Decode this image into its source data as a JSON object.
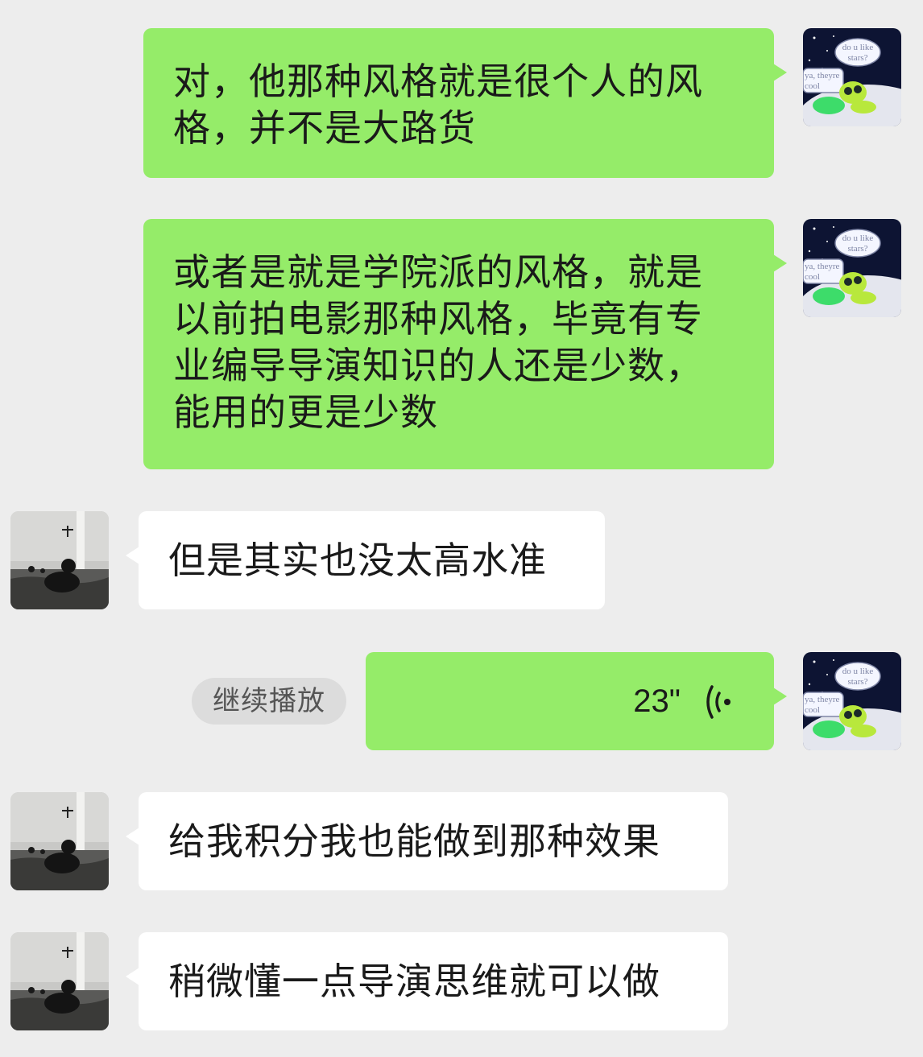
{
  "messages": [
    {
      "side": "right",
      "type": "text",
      "text_lines": [
        "对，他那种风格就是很个人的风",
        "格，并不是大路货"
      ]
    },
    {
      "side": "right",
      "type": "text",
      "text_lines": [
        "或者是就是学院派的风格，就是",
        "以前拍电影那种风格，毕竟有专",
        "业编导导演知识的人还是少数，",
        "能用的更是少数"
      ]
    },
    {
      "side": "left",
      "type": "text",
      "text_lines": [
        "但是其实也没太高水准"
      ]
    },
    {
      "side": "right",
      "type": "voice",
      "duration": "23\"",
      "continue_label": "继续播放"
    },
    {
      "side": "left",
      "type": "text",
      "text_lines": [
        "给我积分我也能做到那种效果"
      ]
    },
    {
      "side": "left",
      "type": "text",
      "text_lines": [
        "稍微懂一点导演思维就可以做"
      ]
    }
  ],
  "avatars": {
    "self": {
      "icon": "alien-cartoon-avatar",
      "caption_top": [
        "do u like",
        "stars?"
      ],
      "caption_left": [
        "ya, theyre",
        "cool"
      ]
    },
    "other": {
      "icon": "ocean-swimmer-photo-avatar"
    }
  },
  "colors": {
    "background": "#ededed",
    "mine_bubble": "#95ec69",
    "their_bubble": "#ffffff",
    "text": "#1a1a1a",
    "pill": "#dcdcdc"
  }
}
